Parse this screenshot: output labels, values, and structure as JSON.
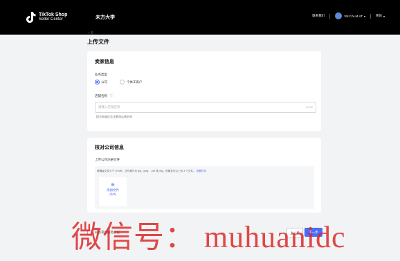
{
  "header": {
    "logo_line1": "TikTok Shop",
    "logo_line2": "Seller Center",
    "title": "未方大学",
    "contact": "联系我们",
    "account": "VN.CALM.AT",
    "language": "简体"
  },
  "back_label": "< 家",
  "page_title": "上传文件",
  "seller_info": {
    "title": "卖家信息",
    "business_type_label": "业务类型",
    "options": [
      "公司",
      "个体工商户"
    ],
    "selected": "公司",
    "shop_name_label": "店铺名称",
    "shop_name_placeholder": "请输入店铺名称",
    "char_count": "0/100",
    "hint": "提交审请后无法更改店铺名称"
  },
  "company_info": {
    "title": "核对公司信息",
    "upload_label": "上传公司注册文件",
    "upload_hint": "请确保文件小于 10 MB，文件格式为 jpg、jpeg、.pdf 或 png。您最多可以上传 3 个文件。",
    "example_link": "查看样本",
    "add_file": "添加文件",
    "file_count": "(0/3)"
  },
  "agreement": "同意平台服务协议",
  "buttons": {
    "prev": "上一步",
    "next": "下一步"
  },
  "watermark": "微信号： muhuanidc",
  "colors": {
    "accent": "#4a6cf7",
    "topbar": "#000000",
    "watermark": "#dc2828"
  }
}
